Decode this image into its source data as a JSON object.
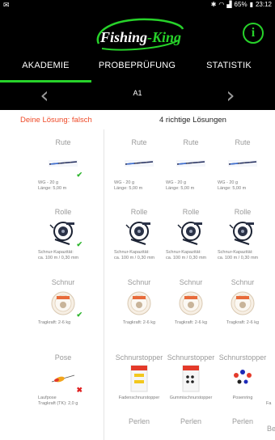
{
  "status": {
    "time": "23:12",
    "battery": "65%"
  },
  "header": {
    "logo_part1": "Fishing",
    "logo_part2": "-King",
    "info_label": "i",
    "chapter": "A1"
  },
  "tabs": [
    {
      "label": "AKADEMIE",
      "active": true
    },
    {
      "label": "PROBEPRÜFUNG",
      "active": false
    },
    {
      "label": "STATISTIK",
      "active": false
    }
  ],
  "result": {
    "your_solution": "Deine Lösung: falsch",
    "correct_solutions": "4 richtige Lösungen"
  },
  "rows": [
    {
      "user": {
        "category": "Rute",
        "desc": [
          "WG - 20 g",
          "Länge: 5,00 m"
        ],
        "icon": "rod-image",
        "mark": "✔",
        "mark_type": "ok"
      },
      "solutions": [
        {
          "category": "Rute",
          "desc": [
            "WG - 20 g",
            "Länge: 5,00 m"
          ],
          "icon": "rod-image"
        },
        {
          "category": "Rute",
          "desc": [
            "WG - 20 g",
            "Länge: 5,00 m"
          ],
          "icon": "rod-image"
        },
        {
          "category": "Rute",
          "desc": [
            "WG - 20 g",
            "Länge: 5,00 m"
          ],
          "icon": "rod-image"
        }
      ]
    },
    {
      "user": {
        "category": "Rolle",
        "desc": [
          "Schnur-Kapazität:",
          "ca. 100 m / 0,30 mm"
        ],
        "icon": "reel-image",
        "mark": "✔",
        "mark_type": "ok"
      },
      "solutions": [
        {
          "category": "Rolle",
          "desc": [
            "Schnur-Kapazität:",
            "ca. 100 m / 0,30 mm"
          ],
          "icon": "reel-image"
        },
        {
          "category": "Rolle",
          "desc": [
            "Schnur-Kapazität:",
            "ca. 100 m / 0,30 mm"
          ],
          "icon": "reel-image"
        },
        {
          "category": "Rolle",
          "desc": [
            "Schnur-Kapazität:",
            "ca. 100 m / 0,30 mm"
          ],
          "icon": "reel-image"
        }
      ]
    },
    {
      "user": {
        "category": "Schnur",
        "desc": [
          "Tragkraft: 2-6 kg"
        ],
        "icon": "line-spool-image",
        "mark": "✔",
        "mark_type": "ok"
      },
      "solutions": [
        {
          "category": "Schnur",
          "desc": [
            "Tragkraft: 2-6 kg"
          ],
          "icon": "line-spool-image"
        },
        {
          "category": "Schnur",
          "desc": [
            "Tragkraft: 2-6 kg"
          ],
          "icon": "line-spool-image"
        },
        {
          "category": "Schnur",
          "desc": [
            "Tragkraft: 2-6 kg"
          ],
          "icon": "line-spool-image"
        }
      ]
    },
    {
      "user": {
        "category": "Pose",
        "desc": [
          "Laufpose",
          "Tragkraft (TK): 2,0 g"
        ],
        "icon": "float-image",
        "mark": "✖",
        "mark_type": "no"
      },
      "solutions": [
        {
          "category": "Schnurstopper",
          "desc": [
            "Fadenschnurstopper"
          ],
          "icon": "line-stopper-image"
        },
        {
          "category": "Schnurstopper",
          "desc": [
            "Gummischnurstopper"
          ],
          "icon": "rubber-stopper-image"
        },
        {
          "category": "Schnurstopper",
          "desc": [
            "Posenring"
          ],
          "icon": "float-ring-image"
        }
      ]
    },
    {
      "user": null,
      "solutions": [
        {
          "category": "Perlen",
          "desc": [],
          "icon": "beads-image"
        },
        {
          "category": "Perlen",
          "desc": [],
          "icon": "beads-image"
        },
        {
          "category": "Perlen",
          "desc": [],
          "icon": "beads-image"
        }
      ]
    }
  ],
  "partial_right_column": {
    "row4_desc": "Fa",
    "row5_category": "Be"
  }
}
